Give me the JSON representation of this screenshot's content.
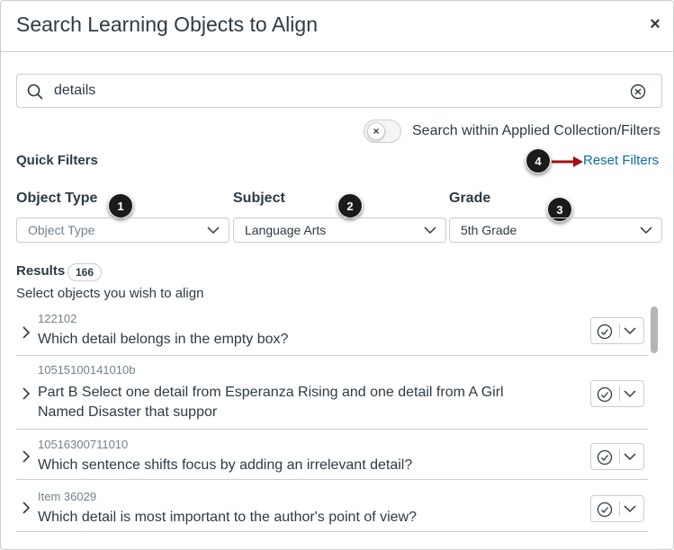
{
  "dialog": {
    "title": "Search Learning Objects to Align",
    "close_label": "×"
  },
  "search": {
    "value": "details",
    "icon": "search-icon",
    "clear_icon": "clear-icon"
  },
  "toggle": {
    "label": "Search within Applied Collection/Filters",
    "knob": "×",
    "state": "off"
  },
  "quick_filters": {
    "heading": "Quick Filters",
    "reset_label": "Reset Filters",
    "filters": [
      {
        "label": "Object Type",
        "value": "Object Type",
        "is_placeholder": true,
        "badge": "1"
      },
      {
        "label": "Subject",
        "value": "Language Arts",
        "is_placeholder": false,
        "badge": "2"
      },
      {
        "label": "Grade",
        "value": "5th Grade",
        "is_placeholder": false,
        "badge": "3"
      }
    ],
    "reset_badge": "4"
  },
  "results": {
    "heading": "Results",
    "count": "166",
    "instructions": "Select objects you wish to align",
    "items": [
      {
        "id": "122102",
        "title": "Which detail belongs in the empty box?"
      },
      {
        "id": "10515100141010b",
        "title": "Part B Select one detail from Esperanza Rising and one detail from A Girl Named Disaster that suppor"
      },
      {
        "id": "10516300711010",
        "title": "Which sentence shifts focus by adding an irrelevant detail?"
      },
      {
        "id": "Item 36029",
        "title": "Which detail is most important to the author's point of view?"
      }
    ]
  },
  "colors": {
    "link": "#0770a3",
    "text": "#2d3b45",
    "border": "#c7cdd1",
    "annotation_arrow": "#a50f0f",
    "badge": "#1b1b1b"
  }
}
